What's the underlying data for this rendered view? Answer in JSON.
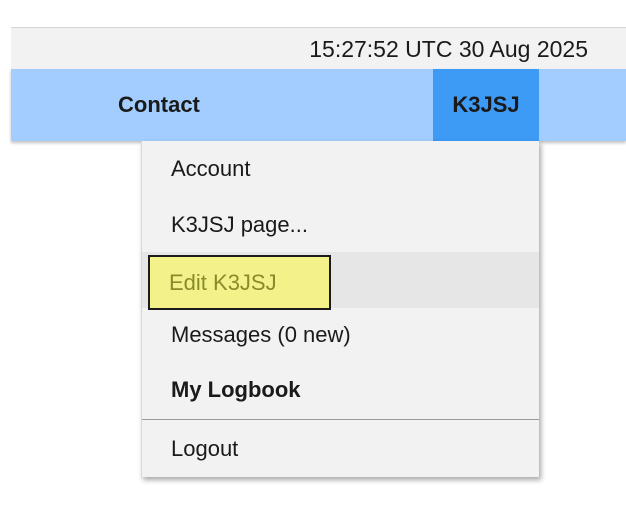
{
  "header": {
    "clock_text": "15:27:52 UTC 30 Aug 2025"
  },
  "nav": {
    "contact_label": "Contact",
    "user_label": "K3JSJ"
  },
  "dropdown": {
    "items": [
      {
        "label": "Account"
      },
      {
        "label": "K3JSJ page..."
      },
      {
        "label": "Edit K3JSJ",
        "highlighted": true
      },
      {
        "label": "Messages (0 new)"
      },
      {
        "label": "My Logbook",
        "bold": true
      },
      {
        "label": "Logout"
      }
    ]
  },
  "colors": {
    "navbar_bg": "#a3cdff",
    "active_user_bg": "#3d9af5",
    "highlight_fill": "#f3f28a",
    "highlight_text": "#8a8a2a"
  }
}
